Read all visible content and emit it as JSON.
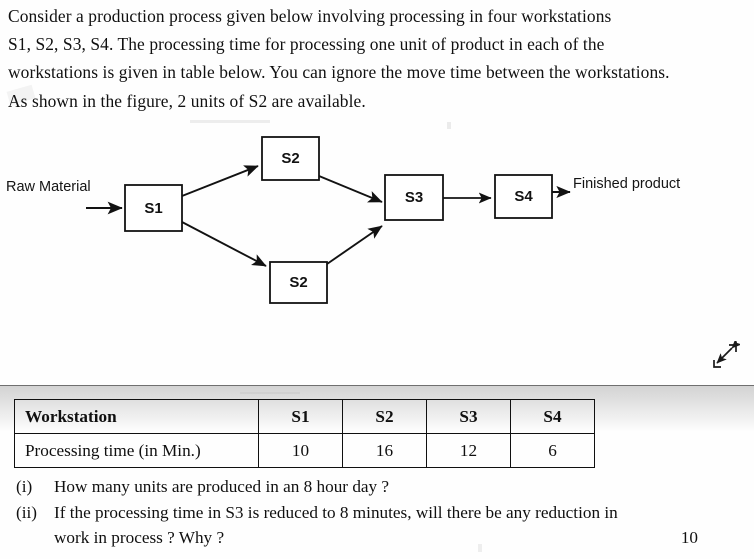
{
  "document": {
    "intro_lines": [
      "Consider a production process given below involving processing in four workstations",
      "S1, S2, S3, S4. The processing time for processing one unit of product in each of the",
      "workstations is given in table below. You can ignore the move time between the workstations.",
      "As shown in the figure, 2 units of S2 are available."
    ]
  },
  "diagram": {
    "input_label": "Raw Material",
    "output_label": "Finished product",
    "nodes": [
      {
        "id": "s1",
        "label": "S1"
      },
      {
        "id": "s2_top",
        "label": "S2"
      },
      {
        "id": "s2_bottom",
        "label": "S2"
      },
      {
        "id": "s3",
        "label": "S3"
      },
      {
        "id": "s4",
        "label": "S4"
      }
    ]
  },
  "table": {
    "headers": [
      "Workstation",
      "S1",
      "S2",
      "S3",
      "S4"
    ],
    "rows": [
      {
        "label": "Processing time (in Min.)",
        "values": [
          "10",
          "16",
          "12",
          "6"
        ]
      }
    ]
  },
  "questions": [
    {
      "number": "(i)",
      "line1": "How many units are produced in an 8 hour day ?",
      "line2": ""
    },
    {
      "number": "(ii)",
      "line1": "If the processing time in S3 is reduced to 8 minutes, will there be any reduction in",
      "line2": "work in process ? Why ?"
    }
  ],
  "marks": "10",
  "cursor": {
    "icon": "resize-diagonal-icon"
  }
}
